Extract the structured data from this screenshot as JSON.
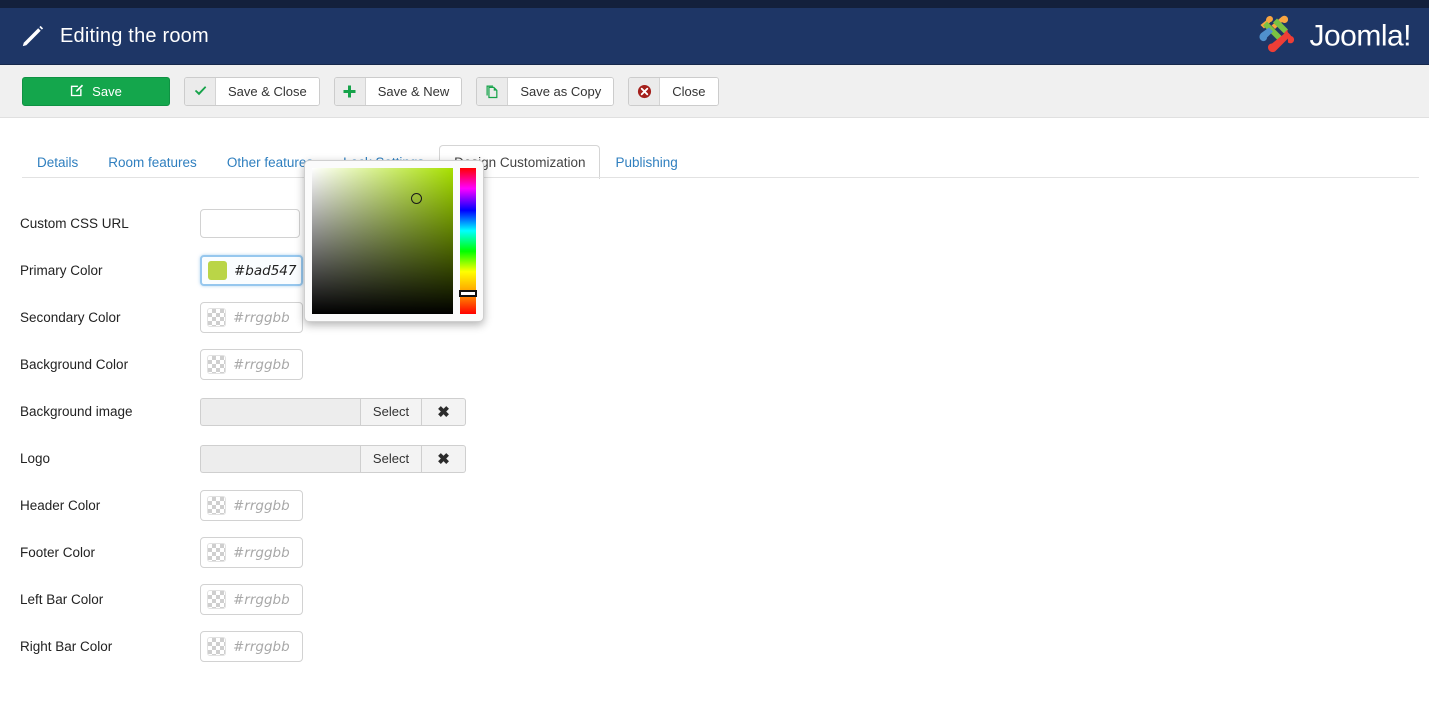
{
  "header": {
    "title": "Editing the room",
    "pencil_icon": "pencil-icon",
    "brand_name": "Joomla!",
    "brand_trademark": "®",
    "bar_color": "#1e3666",
    "top_strip_color": "#13203c"
  },
  "toolbar": {
    "save_label": "Save",
    "save_close_label": "Save & Close",
    "save_new_label": "Save & New",
    "save_copy_label": "Save as Copy",
    "close_label": "Close",
    "save_button_color": "#14a64c",
    "close_icon_color": "#a5201c"
  },
  "tabs": [
    {
      "label": "Details",
      "active": false
    },
    {
      "label": "Room features",
      "active": false
    },
    {
      "label": "Other features",
      "active": false
    },
    {
      "label": "Lock Settings",
      "active": false
    },
    {
      "label": "Design Customization",
      "active": true
    },
    {
      "label": "Publishing",
      "active": false
    }
  ],
  "form": {
    "custom_css_url": {
      "label": "Custom CSS URL",
      "value": ""
    },
    "primary_color": {
      "label": "Primary Color",
      "value": "#bad547",
      "swatch_color": "#bad547",
      "focused": true
    },
    "secondary_color": {
      "label": "Secondary Color",
      "placeholder": "#rrggbb",
      "value": ""
    },
    "background_color": {
      "label": "Background Color",
      "placeholder": "#rrggbb",
      "value": ""
    },
    "background_image": {
      "label": "Background image",
      "value": "",
      "select_label": "Select",
      "clear_label": "✖"
    },
    "logo": {
      "label": "Logo",
      "value": "",
      "select_label": "Select",
      "clear_label": "✖"
    },
    "header_color": {
      "label": "Header Color",
      "placeholder": "#rrggbb",
      "value": ""
    },
    "footer_color": {
      "label": "Footer Color",
      "placeholder": "#rrggbb",
      "value": ""
    },
    "left_bar_color": {
      "label": "Left Bar Color",
      "placeholder": "#rrggbb",
      "value": ""
    },
    "right_bar_color": {
      "label": "Right Bar Color",
      "placeholder": "#rrggbb",
      "value": ""
    }
  },
  "color_picker": {
    "open": true,
    "selected_color": "#bad547",
    "hue_base_color": "#a7e000"
  }
}
